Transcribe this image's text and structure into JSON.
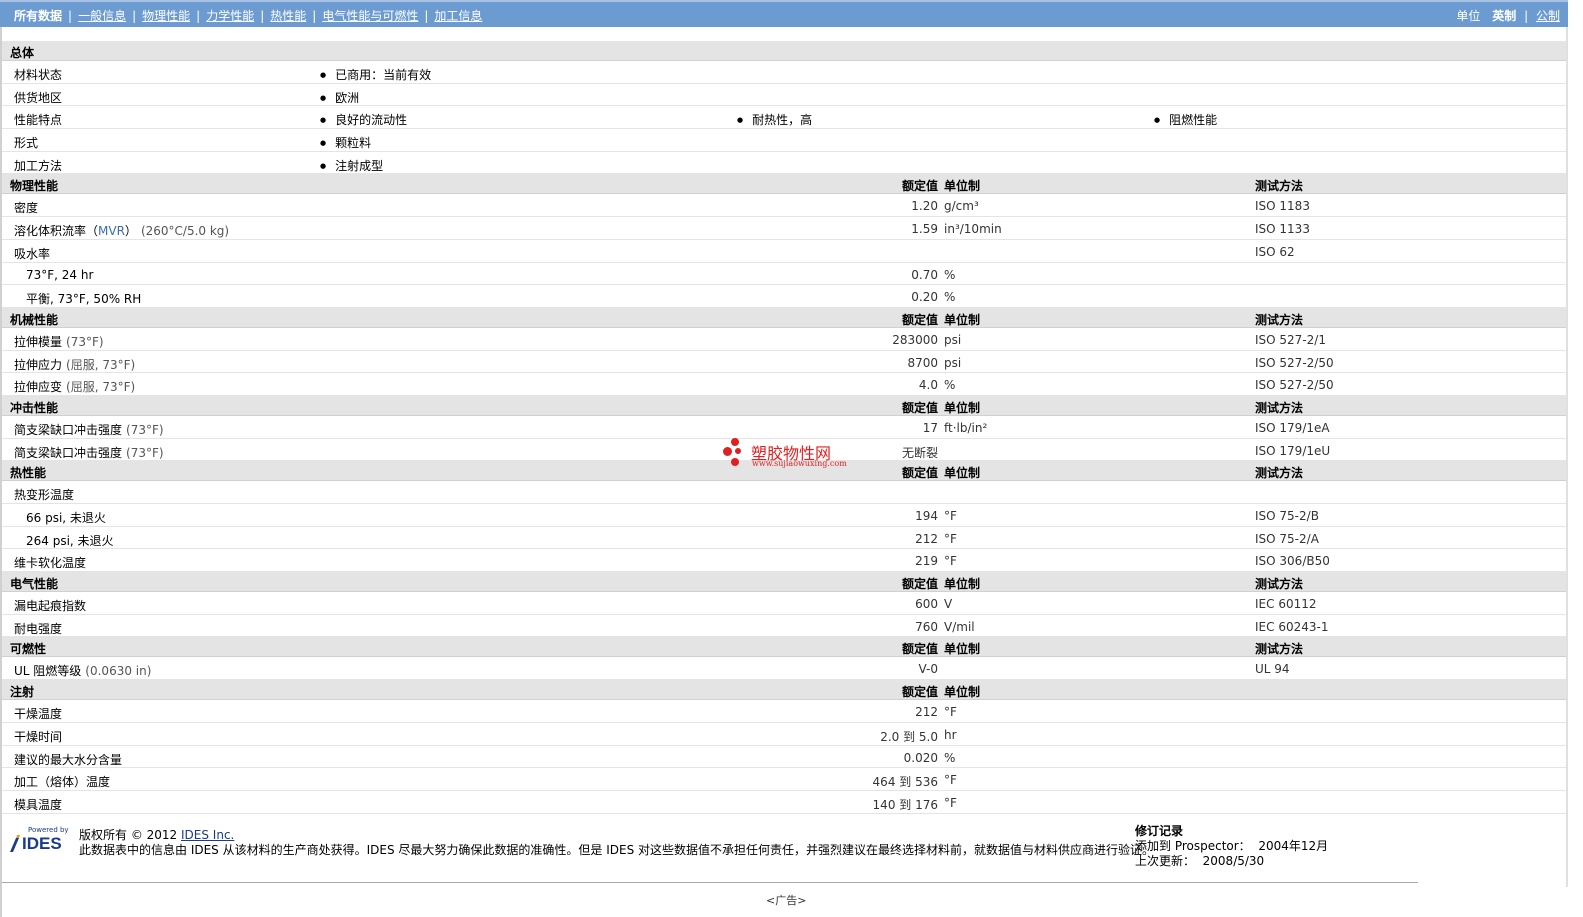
{
  "nav": {
    "tabs": [
      "所有数据",
      "一般信息",
      "物理性能",
      "力学性能",
      "热性能",
      "电气性能与可燃性",
      "加工信息"
    ],
    "units_label": "单位",
    "unit_english": "英制",
    "unit_metric": "公制"
  },
  "general": {
    "title": "总体",
    "rows": [
      {
        "label": "材料状态",
        "items": [
          "已商用：当前有效"
        ]
      },
      {
        "label": "供货地区",
        "items": [
          "欧洲"
        ]
      },
      {
        "label": "性能特点",
        "items": [
          "良好的流动性",
          "耐热性，高",
          "阻燃性能"
        ]
      },
      {
        "label": "形式",
        "items": [
          "颗粒料"
        ]
      },
      {
        "label": "加工方法",
        "items": [
          "注射成型"
        ]
      }
    ]
  },
  "headers": {
    "value": "额定值",
    "unit": "单位制",
    "method": "测试方法"
  },
  "sections": [
    {
      "title": "物理性能",
      "has_method": true,
      "rows": [
        {
          "name": "密度",
          "value": "1.20",
          "unit": "g/cm³",
          "method": "ISO 1183"
        },
        {
          "name": "溶化体积流率（",
          "abbr": "MVR",
          "name2": "）",
          "cond": "(260°C/5.0 kg)",
          "value": "1.59",
          "unit": "in³/10min",
          "method": "ISO 1133"
        },
        {
          "name": "吸水率",
          "value": "",
          "unit": "",
          "method": "ISO 62"
        },
        {
          "name": "73°F, 24 hr",
          "sub": true,
          "value": "0.70",
          "unit": "%",
          "method": ""
        },
        {
          "name": "平衡, 73°F, 50% RH",
          "sub": true,
          "value": "0.20",
          "unit": "%",
          "method": ""
        }
      ]
    },
    {
      "title": "机械性能",
      "has_method": true,
      "rows": [
        {
          "name": "拉伸模量",
          "cond": "(73°F)",
          "value": "283000",
          "unit": "psi",
          "method": "ISO 527-2/1"
        },
        {
          "name": "拉伸应力",
          "cond": "(屈服, 73°F)",
          "value": "8700",
          "unit": "psi",
          "method": "ISO 527-2/50"
        },
        {
          "name": "拉伸应变",
          "cond": "(屈服, 73°F)",
          "value": "4.0",
          "unit": "%",
          "method": "ISO 527-2/50"
        }
      ]
    },
    {
      "title": "冲击性能",
      "has_method": true,
      "rows": [
        {
          "name": "简支梁缺口冲击强度",
          "cond": "(73°F)",
          "value": "17",
          "unit": "ft·lb/in²",
          "method": "ISO 179/1eA"
        },
        {
          "name": "简支梁缺口冲击强度",
          "cond": "(73°F)",
          "value": "无断裂",
          "unit": "",
          "method": "ISO 179/1eU"
        }
      ]
    },
    {
      "title": "热性能",
      "has_method": true,
      "rows": [
        {
          "name": "热变形温度",
          "value": "",
          "unit": "",
          "method": ""
        },
        {
          "name": "66 psi, 未退火",
          "sub": true,
          "value": "194",
          "unit": "°F",
          "method": "ISO 75-2/B"
        },
        {
          "name": "264 psi, 未退火",
          "sub": true,
          "value": "212",
          "unit": "°F",
          "method": "ISO 75-2/A"
        },
        {
          "name": "维卡软化温度",
          "value": "219",
          "unit": "°F",
          "method": "ISO 306/B50"
        }
      ]
    },
    {
      "title": "电气性能",
      "has_method": true,
      "rows": [
        {
          "name": "漏电起痕指数",
          "value": "600",
          "unit": "V",
          "method": "IEC 60112"
        },
        {
          "name": "耐电强度",
          "value": "760",
          "unit": "V/mil",
          "method": "IEC 60243-1"
        }
      ]
    },
    {
      "title": "可燃性",
      "has_method": true,
      "rows": [
        {
          "name": "UL 阻燃等级",
          "cond": "(0.0630 in)",
          "value": "V-0",
          "unit": "",
          "method": "UL 94"
        }
      ]
    },
    {
      "title": "注射",
      "has_method": false,
      "rows": [
        {
          "name": "干燥温度",
          "value": "212",
          "unit": "°F",
          "method": ""
        },
        {
          "name": "干燥时间",
          "value": "2.0 到  5.0",
          "unit": "hr",
          "method": ""
        },
        {
          "name": "建议的最大水分含量",
          "value": "0.020",
          "unit": "%",
          "method": ""
        },
        {
          "name": "加工（熔体）温度",
          "value": "464 到  536",
          "unit": "°F",
          "method": ""
        },
        {
          "name": "模具温度",
          "value": "140 到  176",
          "unit": "°F",
          "method": ""
        }
      ]
    }
  ],
  "footer": {
    "powered_by": "Powered by",
    "logo_text": "IDES",
    "copyright_prefix": "版权所有 © 2012",
    "copyright_link": "IDES Inc.",
    "disclaimer": "此数据表中的信息由 IDES 从该材料的生产商处获得。IDES 尽最大努力确保此数据的准确性。但是 IDES 对这些数据值不承担任何责任，并强烈建议在最终选择材料前，就数据值与材料供应商进行验证。",
    "rev_title": "修订记录",
    "rev_added_label": "添加到 Prospector：",
    "rev_added_value": "2004年12月",
    "rev_updated_label": "上次更新：",
    "rev_updated_value": "2008/5/30"
  },
  "ad_label": "<广告>",
  "watermark": {
    "cn": "塑胶物性网",
    "url": "www.sujiaowuxing.com",
    "color": "#e02020"
  }
}
